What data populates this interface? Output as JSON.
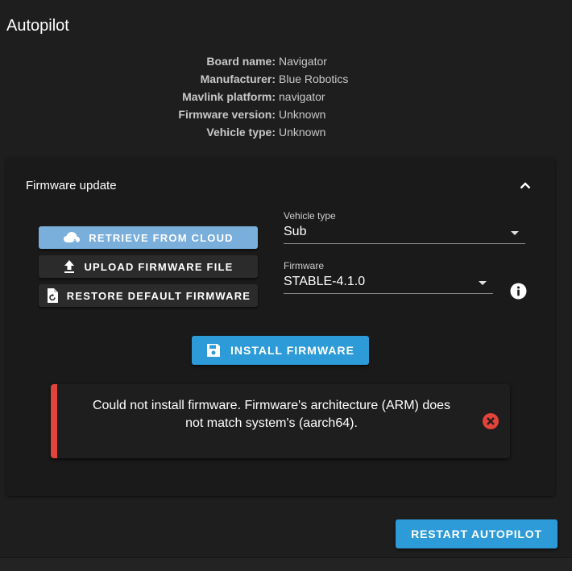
{
  "page": {
    "title": "Autopilot"
  },
  "info": [
    {
      "label": "Board name:",
      "value": "Navigator"
    },
    {
      "label": "Manufacturer:",
      "value": "Blue Robotics"
    },
    {
      "label": "Mavlink platform:",
      "value": "navigator"
    },
    {
      "label": "Firmware version:",
      "value": "Unknown"
    },
    {
      "label": "Vehicle type:",
      "value": "Unknown"
    }
  ],
  "firmware_update": {
    "title": "Firmware update",
    "buttons": {
      "cloud": "RETRIEVE FROM CLOUD",
      "upload": "UPLOAD FIRMWARE FILE",
      "restore": "RESTORE DEFAULT FIRMWARE"
    },
    "vehicle_type": {
      "label": "Vehicle type",
      "value": "Sub"
    },
    "firmware": {
      "label": "Firmware",
      "value": "STABLE-4.1.0"
    },
    "install_label": "INSTALL FIRMWARE",
    "error": "Could not install firmware. Firmware's architecture (ARM) does not match system's (aarch64)."
  },
  "restart_label": "RESTART AUTOPILOT",
  "icons": {
    "collapse": "chevron-up-icon",
    "cloud": "cloud-download-icon",
    "upload": "upload-icon",
    "restore": "file-restore-icon",
    "info": "info-icon",
    "install": "floppy-disk-icon",
    "close": "close-circle-icon"
  },
  "colors": {
    "primary": "#2d9bd8",
    "cloud_button": "#7aaedb",
    "error": "#e0443a"
  }
}
